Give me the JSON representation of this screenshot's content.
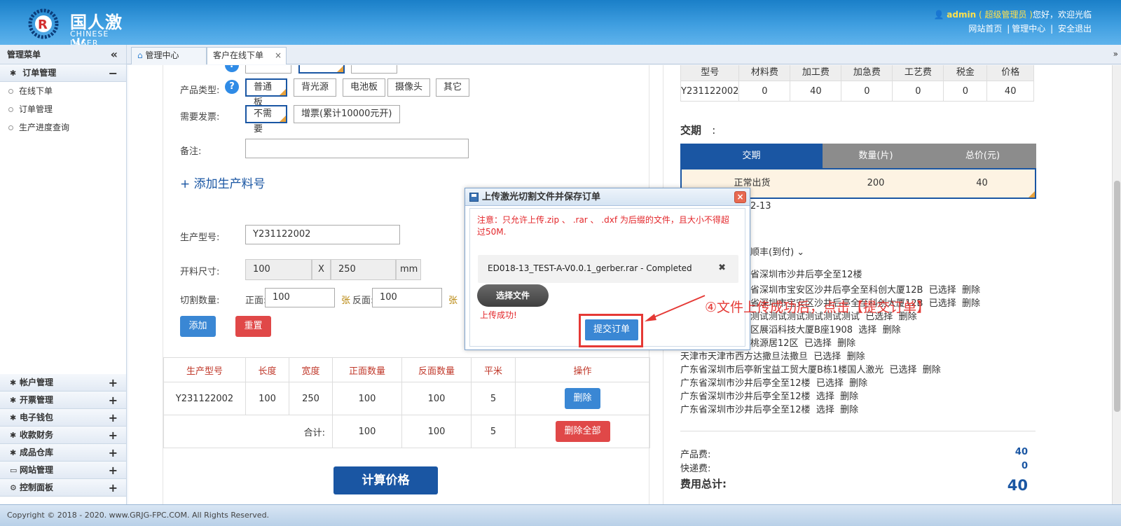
{
  "header": {
    "logo_cn": "国人激光",
    "logo_en": "CHINESE LASER",
    "user_name": "admin",
    "user_role": "( 超级管理员 )",
    "greeting": "您好，欢迎光临",
    "links": [
      "网站首页",
      "管理中心",
      "安全退出"
    ]
  },
  "sidebar": {
    "title": "管理菜单",
    "collapse_icon": "«",
    "order_group": "订单管理",
    "order_items": [
      "在线下单",
      "订单管理",
      "生产进度查询"
    ],
    "groups": [
      "帐户管理",
      "开票管理",
      "电子钱包",
      "收款财务",
      "成品仓库",
      "网站管理",
      "控制面板"
    ]
  },
  "tabs": [
    {
      "label": "管理中心"
    },
    {
      "label": "客户在线下单",
      "close": "×"
    }
  ],
  "tab_more": "»",
  "form": {
    "product_type_label": "产品类型:",
    "product_types": [
      "普通板",
      "背光源",
      "电池板",
      "摄像头",
      "其它"
    ],
    "invoice_label": "需要发票:",
    "invoice_options": [
      "不需要",
      "增票(累计10000元开)"
    ],
    "remark_label": "备注:",
    "add_material": "+ 添加生产料号",
    "model_label": "生产型号:",
    "model_value": "Y231122002",
    "size_label": "开料尺寸:",
    "size_x": "100",
    "size_sep": "X",
    "size_y": "250",
    "size_unit": "mm",
    "cut_label": "切割数量:",
    "front_label": "正面:",
    "front_value": "100",
    "unit_zhang": "张",
    "back_label": "反面:",
    "back_value": "100",
    "add_button": "添加",
    "reset_button": "重置",
    "calc_button": "计算价格"
  },
  "items_table": {
    "headers": [
      "生产型号",
      "长度",
      "宽度",
      "正面数量",
      "反面数量",
      "平米",
      "操作"
    ],
    "row": [
      "Y231122002",
      "100",
      "250",
      "100",
      "100",
      "5"
    ],
    "delete_button": "删除",
    "total_label": "合计:",
    "total_front": "100",
    "total_back": "100",
    "total_area": "5",
    "delete_all_button": "删除全部"
  },
  "price_table": {
    "headers": [
      "型号",
      "材料费",
      "加工费",
      "加急费",
      "工艺费",
      "税金",
      "价格"
    ],
    "row": [
      "Y231122002",
      "0",
      "40",
      "0",
      "0",
      "0",
      "40"
    ]
  },
  "delivery": {
    "title": "交期",
    "colon": ":",
    "headers": [
      "交期",
      "数量(片)",
      "总价(元)"
    ],
    "row": [
      "正常出货",
      "200",
      "40"
    ],
    "date_fragment": "2-13",
    "shipping_fragment": "顺丰(到付)"
  },
  "addresses": [
    {
      "text": "省深圳市沙井后亭全至12楼",
      "status": "",
      "action": ""
    },
    {
      "text": "省深圳市宝安区沙井后亭全至科创大厦12B",
      "status": "已选择",
      "action": "删除"
    },
    {
      "text": "省深圳市宝安区沙井后亭全至科创大厦12B",
      "status": "已选择",
      "action": "删除"
    },
    {
      "text": "测试测试测试测试测试测试",
      "status": "已选择",
      "action": "删除"
    },
    {
      "text": "区展滔科技大厦B座1908",
      "status": "选择",
      "action": "删除"
    },
    {
      "text": "桃源居12区",
      "status": "已选择",
      "action": "删除"
    },
    {
      "text": "天津市天津市西方达撒旦法撒旦",
      "status": "已选择",
      "action": "删除"
    },
    {
      "text": "广东省深圳市后亭新宝益工贸大厦B栋1楼国人激光",
      "status": "已选择",
      "action": "删除"
    },
    {
      "text": "广东省深圳市沙井后亭全至12楼",
      "status": "已选择",
      "action": "删除"
    },
    {
      "text": "广东省深圳市沙井后亭全至12楼",
      "status": "选择",
      "action": "删除"
    },
    {
      "text": "广东省深圳市沙井后亭全至12楼",
      "status": "选择",
      "action": "删除"
    }
  ],
  "fees": {
    "product_label": "产品费:",
    "product_value": "40",
    "express_label": "快递费:",
    "express_value": "0",
    "total_label": "费用总计:",
    "total_value": "40"
  },
  "modal": {
    "title": "上传激光切割文件并保存订单",
    "close": "×",
    "notice": "注意：只允许上传.zip 、 .rar 、 .dxf 为后缀的文件，且大小不得超过50M.",
    "file_name": "ED018-13_TEST-A-V0.0.1_gerber.rar - Completed",
    "file_delete": "✖",
    "choose_button": "选择文件",
    "success_text": "上传成功!",
    "submit_button": "提交订单"
  },
  "annotation": "④文件上传成功后，点击【提交订单】",
  "footer": "Copyright © 2018 - 2020. www.GRJG-FPC.COM. All Rights Reserved.",
  "colors": {
    "header": "#3f9ee0",
    "primary_blue": "#1a56a3",
    "button_blue": "#3a87d4",
    "danger_red": "#e04848",
    "annotation_red": "#e53935"
  }
}
